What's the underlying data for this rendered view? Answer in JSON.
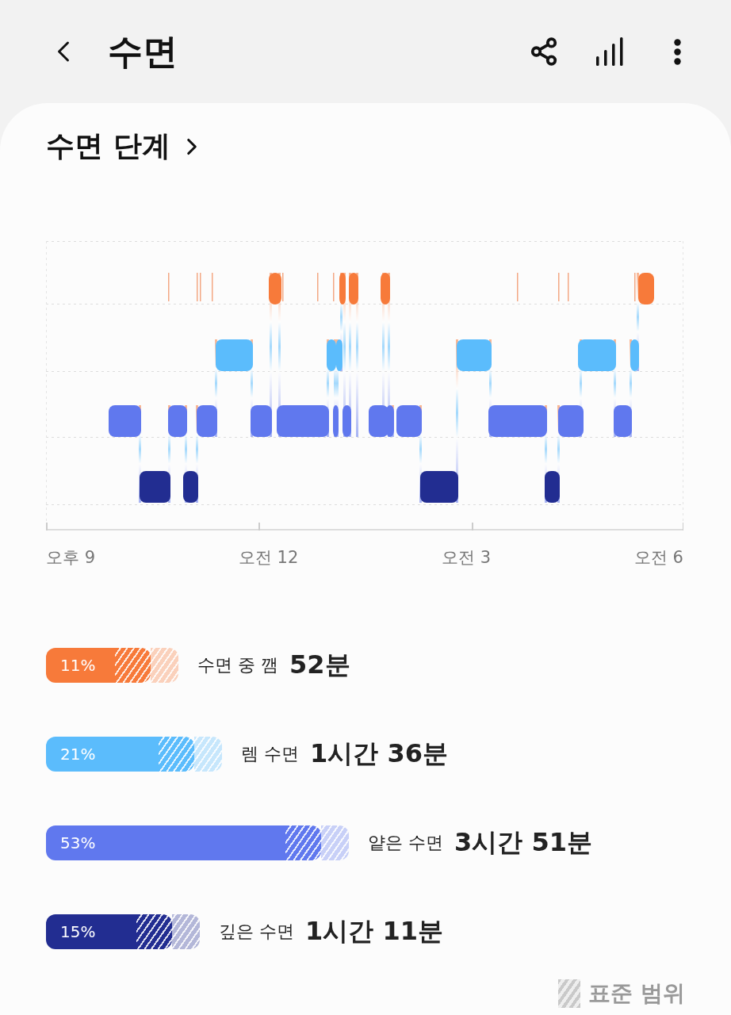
{
  "header": {
    "title": "수면"
  },
  "card": {
    "title": "수면 단계"
  },
  "chart": {
    "x_labels": [
      "오후 9",
      "오전 12",
      "오전 3",
      "오전 6"
    ]
  },
  "stages": [
    {
      "percent": "11%",
      "label": "수면 중 깸",
      "duration": "52분",
      "color": "#f77a3a"
    },
    {
      "percent": "21%",
      "label": "렘 수면",
      "duration": "1시간 36분",
      "color": "#5bbcfc"
    },
    {
      "percent": "53%",
      "label": "얕은 수면",
      "duration": "3시간 51분",
      "color": "#6078ee"
    },
    {
      "percent": "15%",
      "label": "깊은 수면",
      "duration": "1시간 11분",
      "color": "#222d91"
    }
  ],
  "legend": {
    "label": "표준 범위"
  }
}
